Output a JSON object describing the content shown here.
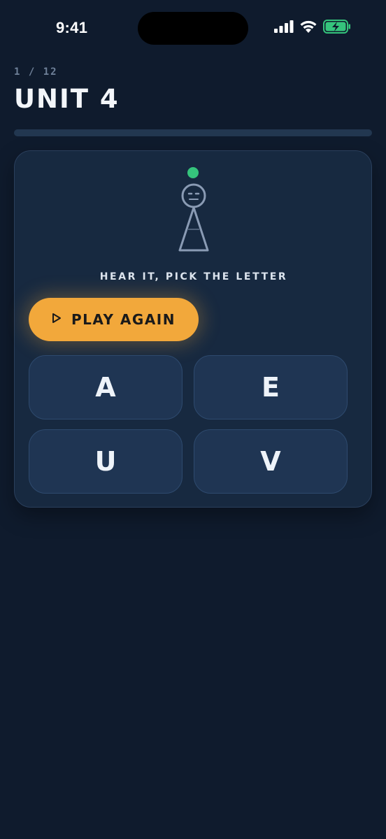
{
  "status_bar": {
    "time": "9:41"
  },
  "header": {
    "progress_text": "1 / 12",
    "title": "UNIT 4",
    "progress": 0.0
  },
  "card": {
    "instruction": "HEAR IT, PICK THE LETTER",
    "play_button_label": "PLAY AGAIN",
    "options": [
      "A",
      "E",
      "U",
      "V"
    ]
  },
  "icons": {
    "signal": "cellular-signal-icon",
    "wifi": "wifi-icon",
    "battery": "battery-charging-icon",
    "play": "play-triangle-icon",
    "avatar": "robot-figure-icon"
  },
  "colors": {
    "background": "#0f1b2d",
    "card": "#172940",
    "accent": "#f2a83b",
    "status_dot": "#35c47c",
    "option_bg": "#1f3553"
  }
}
